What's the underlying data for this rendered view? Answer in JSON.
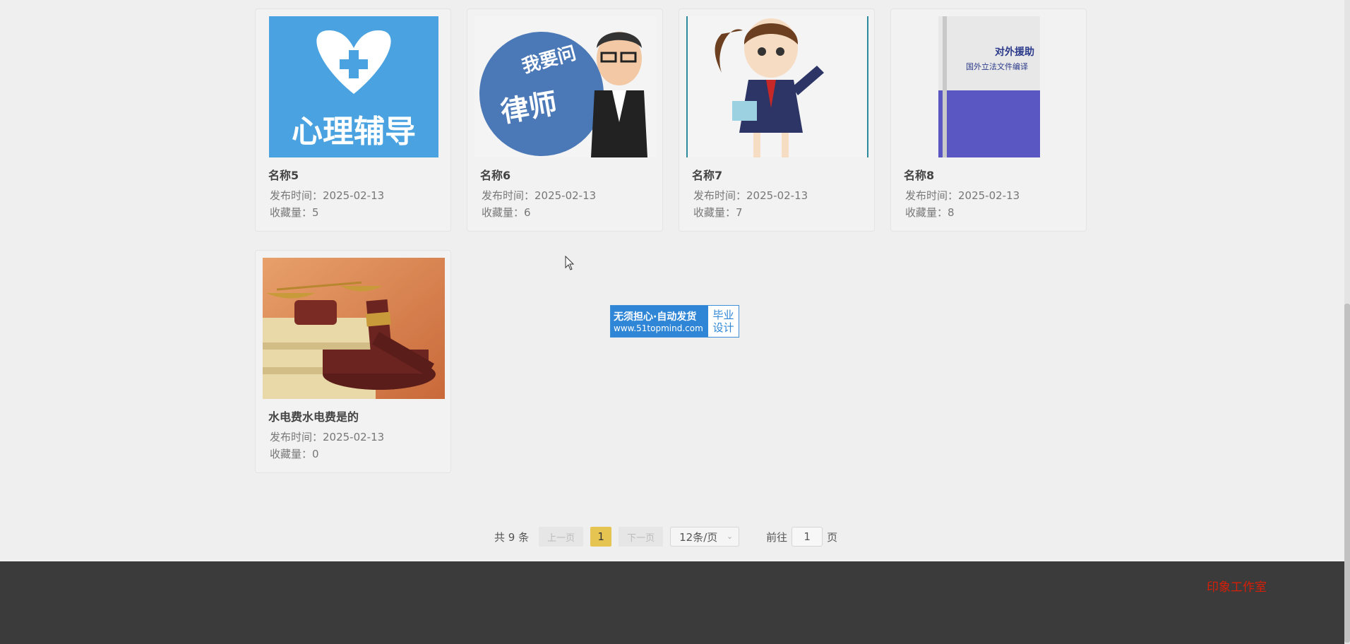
{
  "cards": [
    {
      "title": "名称5",
      "date_label": "发布时间：2025-02-13",
      "fav_label": "收藏量：5",
      "thumb_text": "心理辅导"
    },
    {
      "title": "名称6",
      "date_label": "发布时间：2025-02-13",
      "fav_label": "收藏量：6",
      "thumb_text_a": "我要问",
      "thumb_text_b": "律师"
    },
    {
      "title": "名称7",
      "date_label": "发布时间：2025-02-13",
      "fav_label": "收藏量：7"
    },
    {
      "title": "名称8",
      "date_label": "发布时间：2025-02-13",
      "fav_label": "收藏量：8",
      "thumb_text_a": "对外援助",
      "thumb_text_b": "国外立法文件编译"
    },
    {
      "title": "水电费水电费是的",
      "date_label": "发布时间：2025-02-13",
      "fav_label": "收藏量：0"
    }
  ],
  "pager": {
    "total": "共 9 条",
    "prev": "上一页",
    "current": "1",
    "next": "下一页",
    "page_size": "12条/页",
    "goto_label": "前往",
    "goto_value": "1",
    "page_suffix": "页"
  },
  "ad": {
    "line1": "无须担心·自动发货",
    "line2": "www.51topmind.com",
    "right1": "毕业",
    "right2": "设计"
  },
  "footer": {
    "link": "印象工作室"
  },
  "colors": {
    "accent": "#e6c452",
    "footer_bg": "#3b3b3b",
    "footer_link": "#d81e06"
  }
}
